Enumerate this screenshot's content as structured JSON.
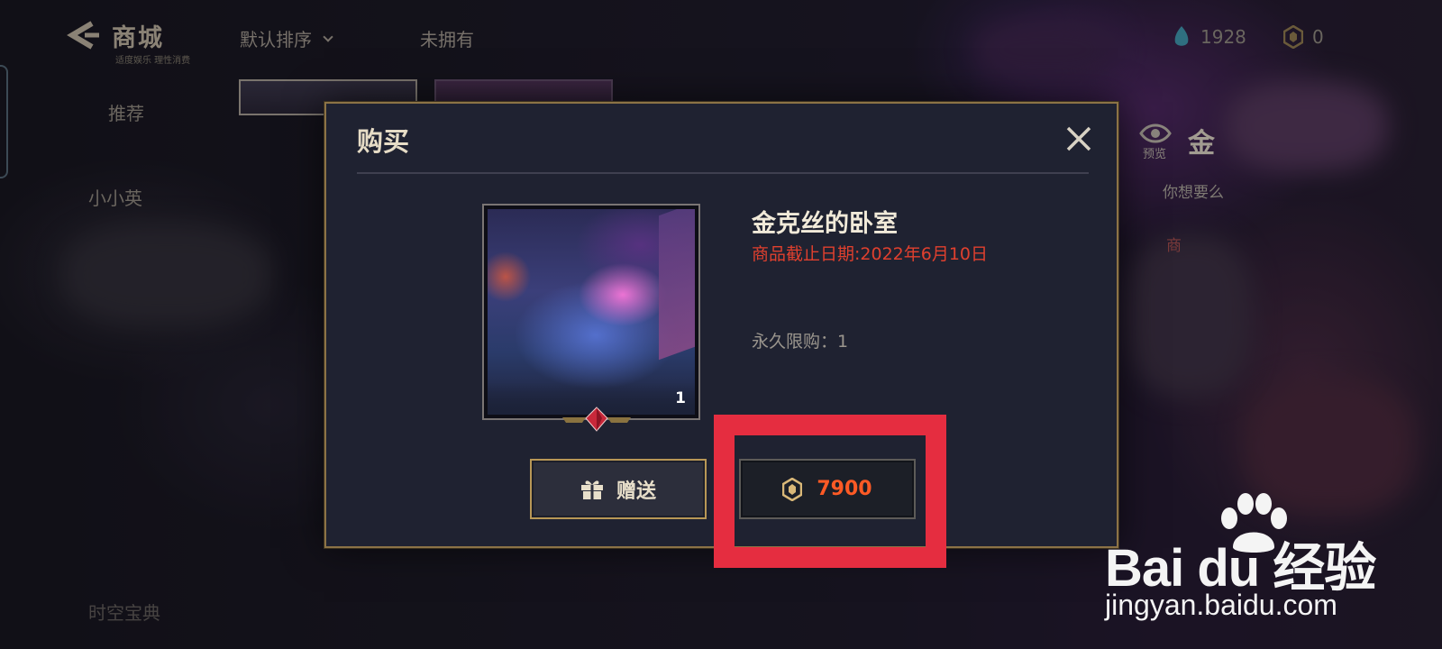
{
  "header": {
    "title": "商城",
    "subtitle": "适度娱乐 理性消费",
    "sort_label": "默认排序",
    "filter_label": "未拥有",
    "currency_primary": "1928",
    "currency_secondary": "0"
  },
  "sidebar": {
    "items": [
      {
        "label": "推荐"
      },
      {
        "label": "小小英"
      },
      {
        "label": "时空宝典"
      }
    ]
  },
  "right_panel": {
    "preview_label": "预览",
    "title": "金",
    "desc": "你想要么",
    "red_text": "商"
  },
  "modal": {
    "title": "购买",
    "item_name": "金克丝的卧室",
    "deadline": "商品截止日期:2022年6月10日",
    "limit": "永久限购：1",
    "item_count": "1",
    "gift_label": "赠送",
    "price": "7900"
  },
  "watermark": {
    "logo_text": "Bai du 经验",
    "url": "jingyan.baidu.com"
  },
  "colors": {
    "accent_gold": "#b89756",
    "price_orange": "#ff5a25",
    "deadline_red": "#e0402e",
    "highlight_red": "#e52d40"
  }
}
